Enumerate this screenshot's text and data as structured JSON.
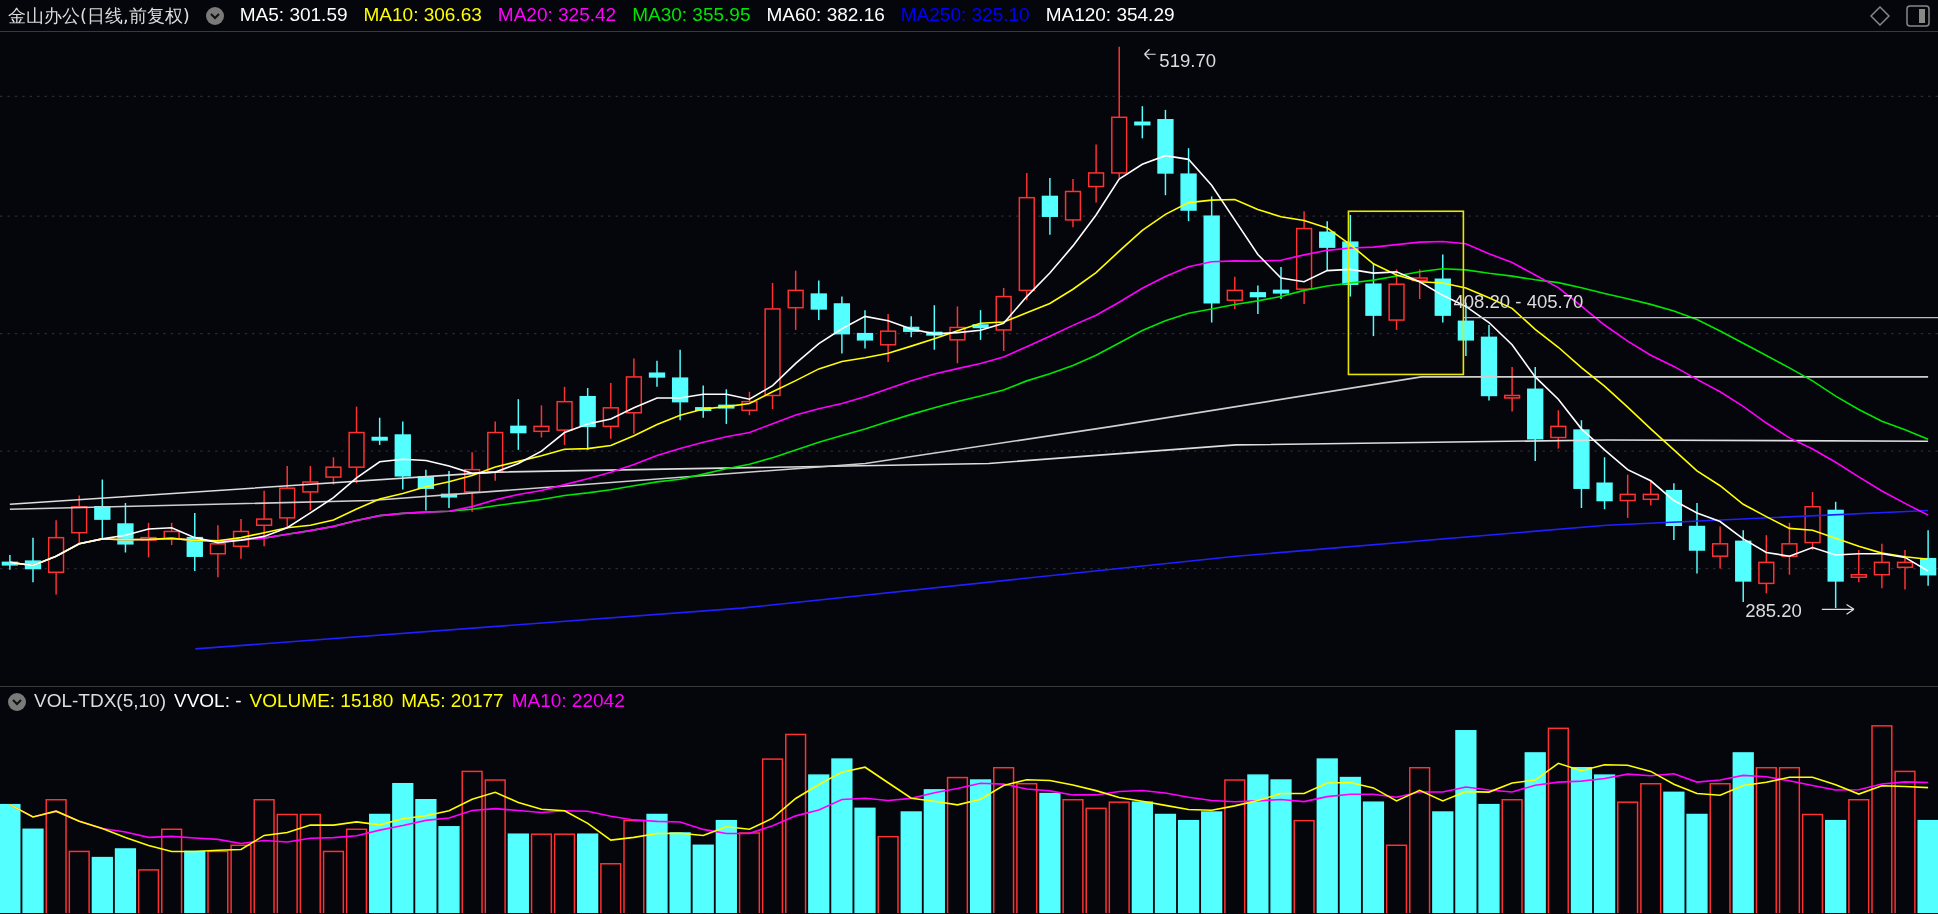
{
  "header": {
    "title": "金山办公(日线,前复权)",
    "indicators": [
      {
        "label": "MA5: 301.59",
        "color": "#ffffff"
      },
      {
        "label": "MA10: 306.63",
        "color": "#ffff00"
      },
      {
        "label": "MA20: 325.42",
        "color": "#ff00ff"
      },
      {
        "label": "MA30: 355.95",
        "color": "#00e600"
      },
      {
        "label": "MA60: 382.16",
        "color": "#ffffff"
      },
      {
        "label": "MA250: 325.10",
        "color": "#0000ff"
      },
      {
        "label": "MA120: 354.29",
        "color": "#ffffff"
      }
    ]
  },
  "price_chart": {
    "annotations": [
      {
        "kind": "high",
        "text": "519.70"
      },
      {
        "kind": "range",
        "text": "408.20 - 405.70"
      },
      {
        "kind": "low",
        "text": "285.20"
      }
    ]
  },
  "volume_panel": {
    "indicator": "VOL-TDX(5,10)",
    "items": [
      {
        "label": "VVOL: -",
        "color": "#ffffff"
      },
      {
        "label": "VOLUME: 15180",
        "color": "#ffff00"
      },
      {
        "label": "MA5: 20177",
        "color": "#ffff00"
      },
      {
        "label": "MA10: 22042",
        "color": "#ff00ff"
      }
    ]
  }
}
